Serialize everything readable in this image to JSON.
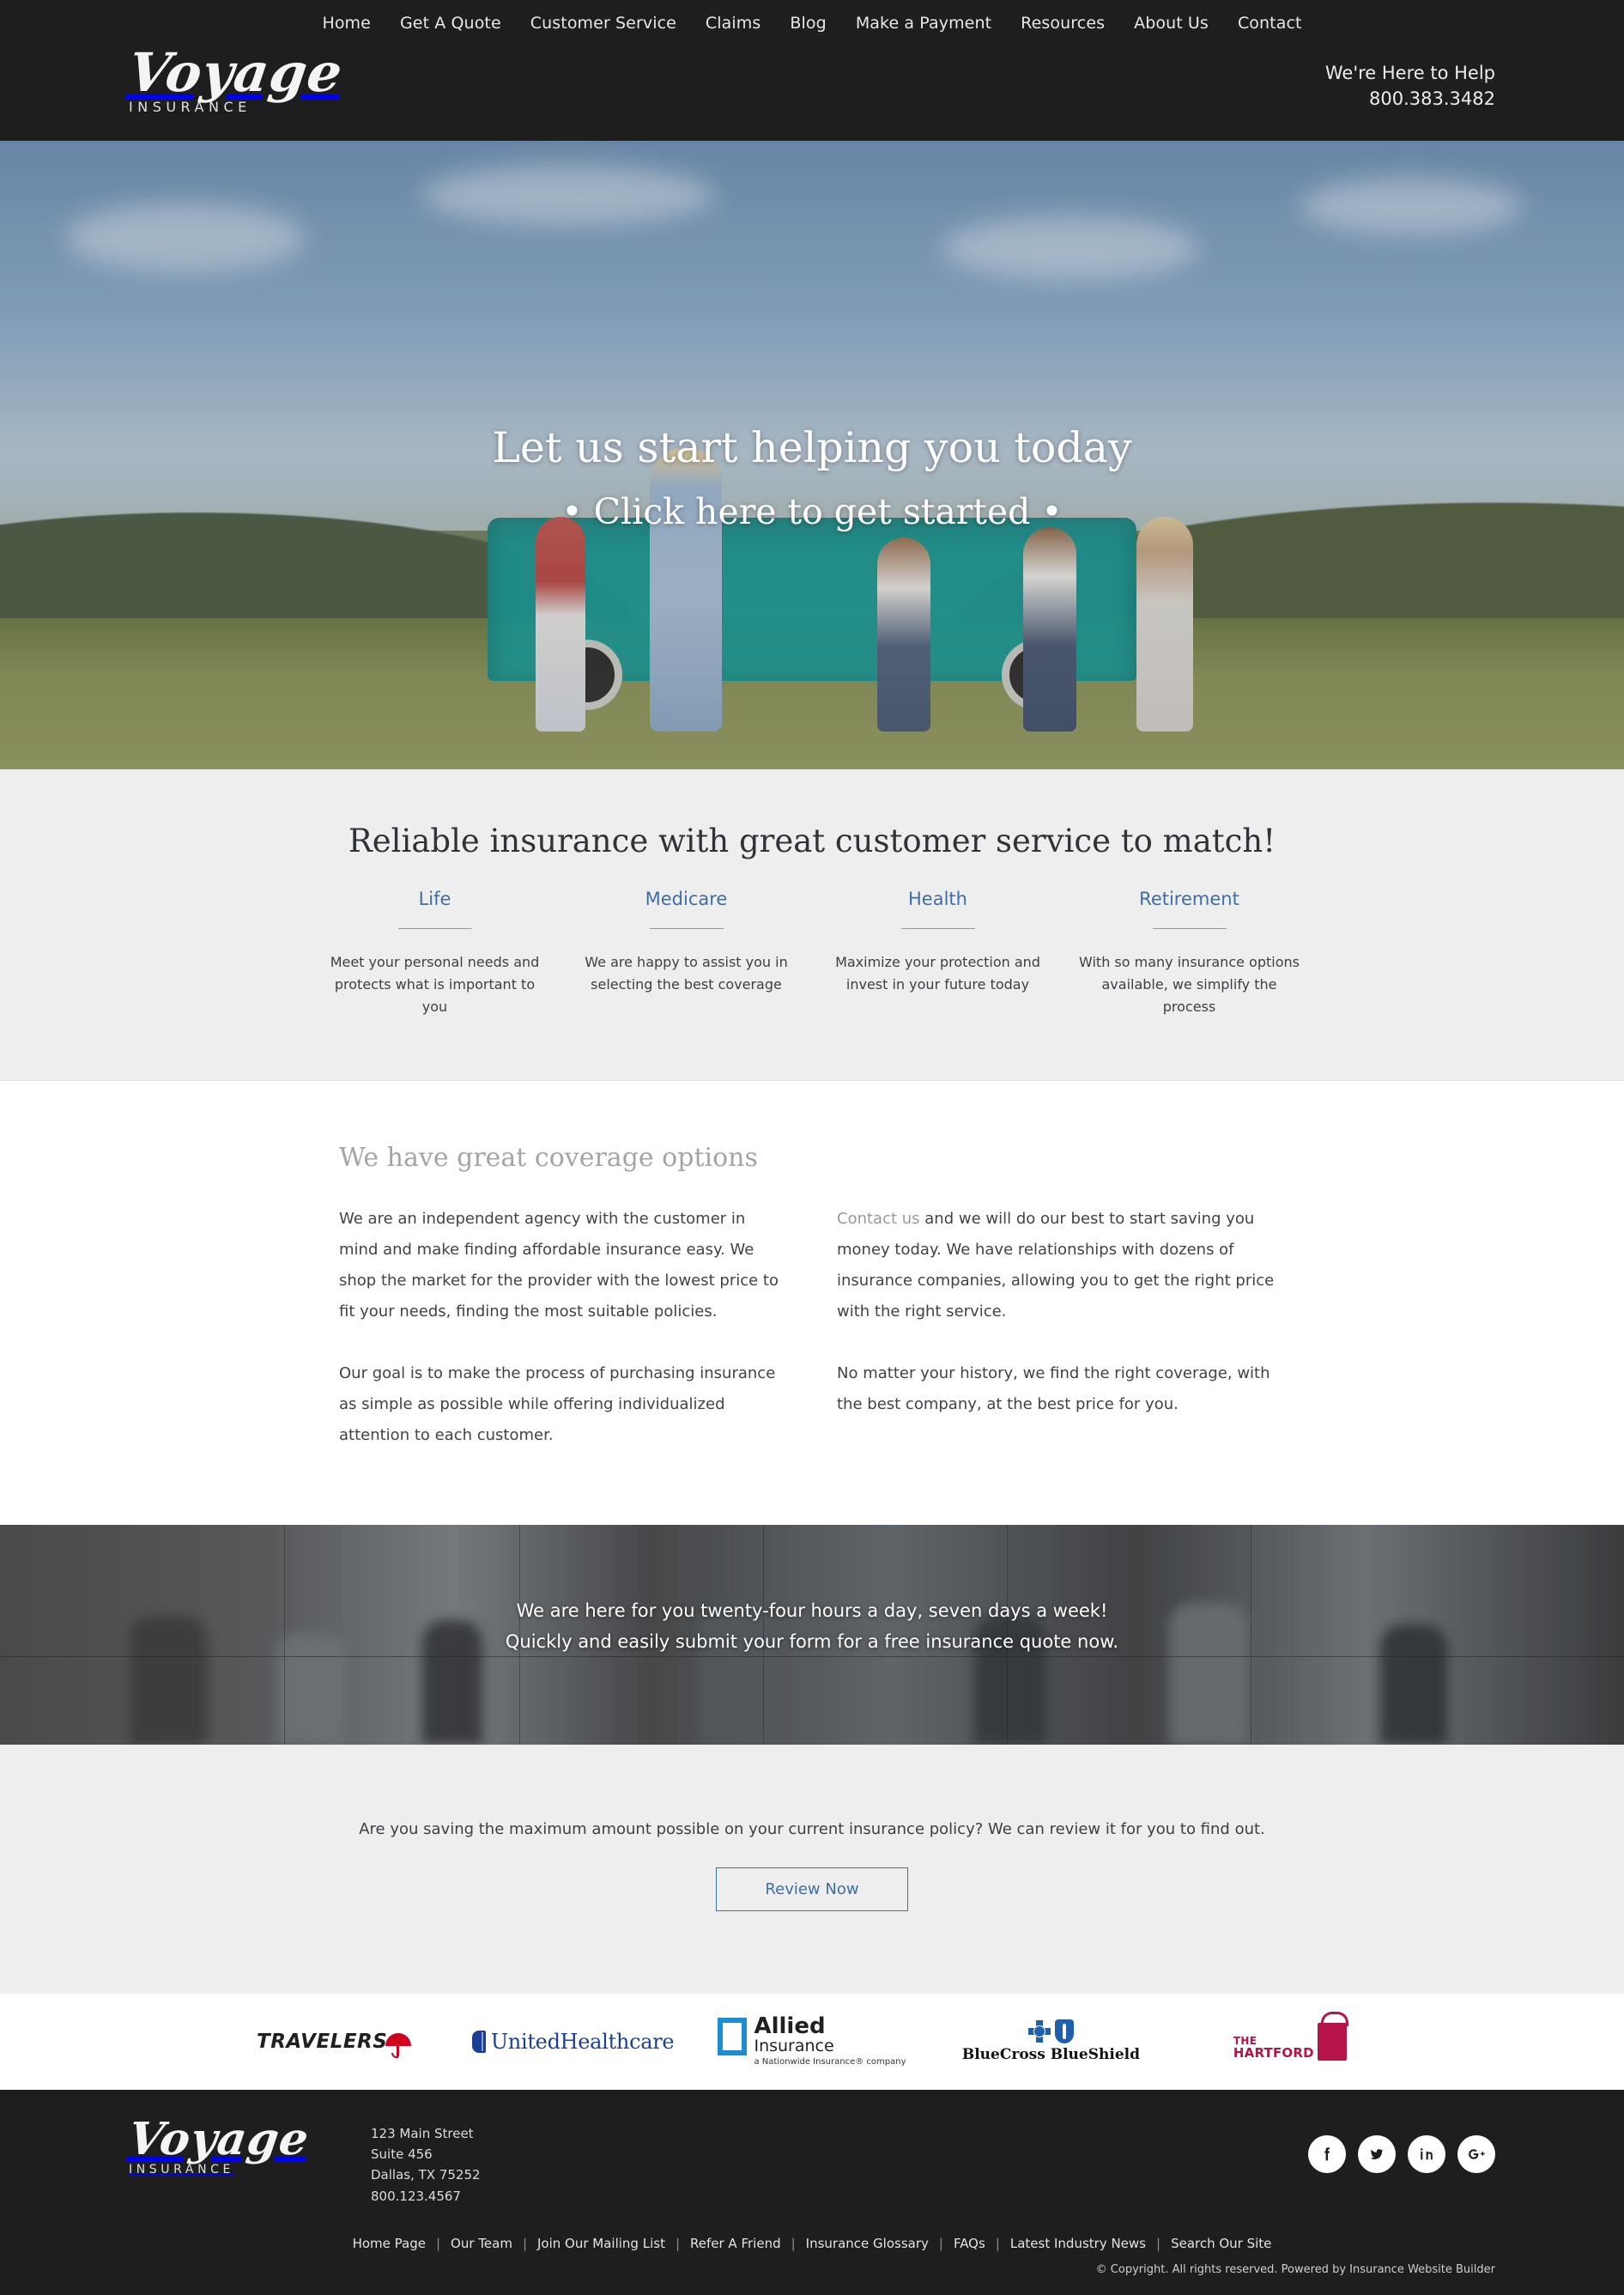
{
  "header": {
    "nav": [
      {
        "label": "Home"
      },
      {
        "label": "Get A Quote"
      },
      {
        "label": "Customer Service"
      },
      {
        "label": "Claims"
      },
      {
        "label": "Blog"
      },
      {
        "label": "Make a Payment"
      },
      {
        "label": "Resources"
      },
      {
        "label": "About Us"
      },
      {
        "label": "Contact"
      }
    ],
    "logo": {
      "name": "Voyage",
      "sub": "INSURANCE"
    },
    "help_label": "We're Here to Help",
    "phone": "800.383.3482"
  },
  "hero": {
    "headline": "Let us start helping you today",
    "subheadline": "• Click here to get started •"
  },
  "services": {
    "heading": "Reliable insurance with great customer service to match!",
    "items": [
      {
        "title": "Life",
        "desc": "Meet your personal needs and protects what is important to you"
      },
      {
        "title": "Medicare",
        "desc": "We are happy to assist you in selecting the best coverage"
      },
      {
        "title": "Health",
        "desc": "Maximize your protection and invest in your future today"
      },
      {
        "title": "Retirement",
        "desc": "With so many insurance options available, we simplify the process"
      }
    ]
  },
  "coverage": {
    "heading": "We have great coverage options",
    "left_p1": "We are an independent agency with the customer in mind and make finding affordable insurance easy. We shop the market for the provider with the lowest price to fit your needs, finding the most suitable policies.",
    "left_p2": "Our goal is to make the process of purchasing insurance as simple as possible while offering individualized attention to each customer.",
    "right_link": "Contact us",
    "right_p1_rest": " and we will do our best to start saving you money today. We have relationships with dozens of insurance companies, allowing you to get the right price with the right service.",
    "right_p2": "No matter your history, we find the right coverage, with the best company, at the best price for you."
  },
  "banner": {
    "line1": "We are here for you twenty-four hours a day, seven days a week!",
    "line2": "Quickly and easily submit your form for a free insurance quote now."
  },
  "cta": {
    "text": "Are you saving the maximum amount possible on your current insurance policy? We can review it for you to find out.",
    "button": "Review Now"
  },
  "carriers": [
    {
      "name": "Travelers",
      "word": "TRAVELERS"
    },
    {
      "name": "UnitedHealthcare",
      "word": "UnitedHealthcare"
    },
    {
      "name": "Allied Insurance",
      "l1": "Allied",
      "l2": "Insurance",
      "l3": "a Nationwide Insurance® company"
    },
    {
      "name": "BlueCross BlueShield",
      "word": "BlueCross BlueShield"
    },
    {
      "name": "The Hartford",
      "l1": "THE",
      "l2": "HARTFORD"
    }
  ],
  "footer": {
    "logo": {
      "name": "Voyage",
      "sub": "INSURANCE"
    },
    "address": [
      "123 Main Street",
      "Suite 456",
      "Dallas, TX 75252",
      "800.123.4567"
    ],
    "social": [
      {
        "name": "facebook",
        "glyph": "f"
      },
      {
        "name": "twitter",
        "glyph": "t"
      },
      {
        "name": "linkedin",
        "glyph": "in"
      },
      {
        "name": "google-plus",
        "glyph": "G+"
      }
    ],
    "links": [
      "Home Page",
      "Our Team",
      "Join Our Mailing List",
      "Refer A Friend",
      "Insurance Glossary",
      "FAQs",
      "Latest Industry News",
      "Search Our Site"
    ],
    "copyright": "© Copyright. All rights reserved. Powered by Insurance Website Builder"
  },
  "colors": {
    "dark": "#1e1e1e",
    "gray_section": "#eeeeee",
    "accent_blue": "#3c6fa8",
    "muted": "#a5a5a0"
  }
}
